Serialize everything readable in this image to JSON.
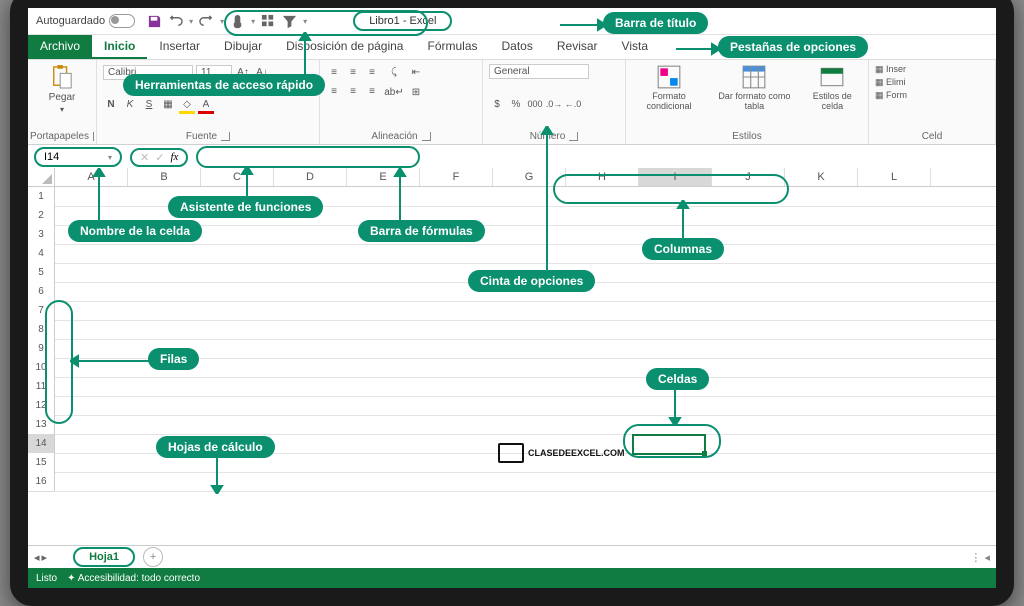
{
  "titlebar": {
    "autosave": "Autoguardado",
    "title": "Libro1  -  Excel"
  },
  "tabs": [
    "Archivo",
    "Inicio",
    "Insertar",
    "Dibujar",
    "Disposición de página",
    "Fórmulas",
    "Datos",
    "Revisar",
    "Vista"
  ],
  "ribbon": {
    "clipboard": {
      "title": "Portapapeles",
      "paste": "Pegar"
    },
    "font": {
      "title": "Fuente",
      "family": "Calibri",
      "size": "11"
    },
    "align": {
      "title": "Alineación"
    },
    "number": {
      "title": "Número",
      "format": "General"
    },
    "styles": {
      "title": "Estilos",
      "cond": "Formato condicional",
      "table": "Dar formato como tabla",
      "cell": "Estilos de celda"
    },
    "cells": {
      "title": "Celd",
      "insert": "Inser",
      "delete": "Elimi",
      "format": "Form"
    }
  },
  "namebox": "I14",
  "columns": [
    "A",
    "B",
    "C",
    "D",
    "E",
    "F",
    "G",
    "H",
    "I",
    "J",
    "K",
    "L"
  ],
  "rowcount": 16,
  "sheet": {
    "name": "Hoja1"
  },
  "status": {
    "ready": "Listo",
    "acc": "Accesibilidad: todo correcto"
  },
  "callouts": {
    "qat": "Herramientas de acceso rápido",
    "title": "Barra de título",
    "tabs": "Pestañas de opciones",
    "name": "Nombre de la celda",
    "fx": "Asistente de funciones",
    "formula": "Barra de fórmulas",
    "cols": "Columnas",
    "ribbon": "Cinta de opciones",
    "rows": "Filas",
    "cells": "Celdas",
    "sheets": "Hojas de cálculo"
  },
  "logo": "CLASEDEEXCEL.COM"
}
